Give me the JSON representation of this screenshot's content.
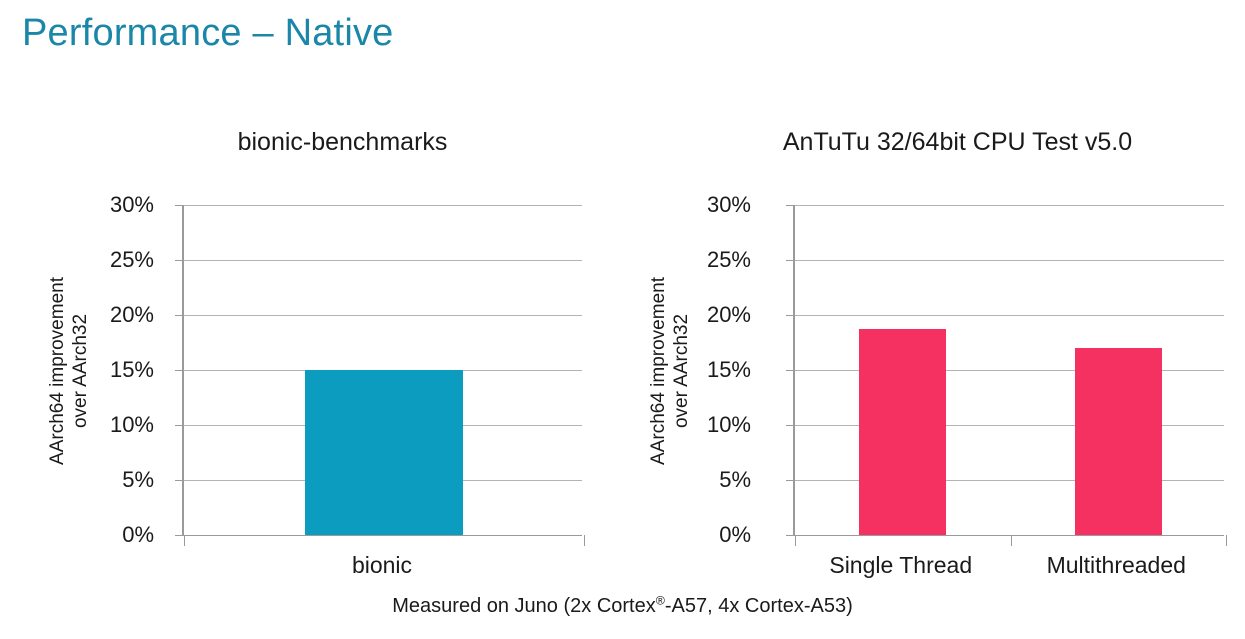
{
  "slide": {
    "title": "Performance – Native",
    "title_color": "#1b87a8",
    "footnote_prefix": "Measured on Juno (2x Cortex",
    "footnote_reg": "®",
    "footnote_suffix": "-A57, 4x Cortex-A53)"
  },
  "axis": {
    "y_title_line1": "AArch64 improvement",
    "y_title_line2": "over AArch32",
    "ticks": [
      "30%",
      "25%",
      "20%",
      "15%",
      "10%",
      "5%",
      "0%"
    ],
    "tick_values": [
      30,
      25,
      20,
      15,
      10,
      5,
      0
    ]
  },
  "chart_data": [
    {
      "type": "bar",
      "title": "bionic-benchmarks",
      "categories": [
        "bionic"
      ],
      "values": [
        15.0
      ],
      "series": [
        {
          "name": "AArch64 improvement over AArch32",
          "values": [
            15.0
          ]
        }
      ],
      "xlabel": "",
      "ylabel": "AArch64 improvement over AArch32",
      "ylim": [
        0,
        30
      ],
      "ytick_labels": [
        "0%",
        "5%",
        "10%",
        "15%",
        "20%",
        "25%",
        "30%"
      ],
      "grid": true,
      "legend": "none",
      "bar_color": "#0b9cbf"
    },
    {
      "type": "bar",
      "title": "AnTuTu 32/64bit CPU Test v5.0",
      "categories": [
        "Single Thread",
        "Multithreaded"
      ],
      "values": [
        18.7,
        17.0
      ],
      "series": [
        {
          "name": "AArch64 improvement over AArch32",
          "values": [
            18.7,
            17.0
          ]
        }
      ],
      "xlabel": "",
      "ylabel": "AArch64 improvement over AArch32",
      "ylim": [
        0,
        30
      ],
      "ytick_labels": [
        "0%",
        "5%",
        "10%",
        "15%",
        "20%",
        "25%",
        "30%"
      ],
      "grid": true,
      "legend": "none",
      "bar_color": "#f43160"
    }
  ]
}
